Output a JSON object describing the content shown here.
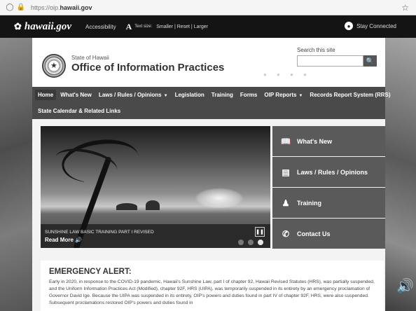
{
  "browser": {
    "url_prefix": "https://oip.",
    "url_domain": "hawaii.gov"
  },
  "topbar": {
    "logo": "hawaii.gov",
    "accessibility": "Accessibility",
    "text_size_label": "Text size:",
    "text_size_options": "Smaller | Reset | Larger",
    "stay_connected": "Stay Connected"
  },
  "header": {
    "state": "State of Hawaii",
    "office": "Office of Information Practices",
    "search_label": "Search this site"
  },
  "nav": {
    "row1": [
      "Home",
      "What's New",
      "Laws / Rules / Opinions",
      "Legislation",
      "Training",
      "Forms",
      "OIP Reports",
      "Records Report System (RRS)"
    ],
    "row2": [
      "State Calendar & Related Links"
    ]
  },
  "slideshow": {
    "caption": "SUNSHINE LAW BASIC TRAINING PART I REVISED",
    "read_more": "Read More",
    "slide_count": 3,
    "active_slide": 3
  },
  "quick_links": [
    {
      "label": "What's New",
      "icon": "book-icon"
    },
    {
      "label": "Laws / Rules / Opinions",
      "icon": "document-icon"
    },
    {
      "label": "Training",
      "icon": "group-icon"
    },
    {
      "label": "Contact Us",
      "icon": "phone-icon"
    }
  ],
  "alert": {
    "title": "EMERGENCY ALERT:",
    "body": "Early in 2020, in response to the COVID-19 pandemic, Hawaii's Sunshine Law, part I of chapter 92, Hawaii Revised Statutes (HRS), was partially suspended, and the Uniform Information Practices Act (Modified), chapter 92F, HRS (UIPA), was temporarily suspended in its entirety by an emergency proclamation of Governor David Ige.  Because the UIPA was suspended in its entirety, OIP's powers and duties found in part IV of chapter 92F, HRS, were also suspended.  Subsequent proclamations restored OIP's powers and duties found in"
  }
}
